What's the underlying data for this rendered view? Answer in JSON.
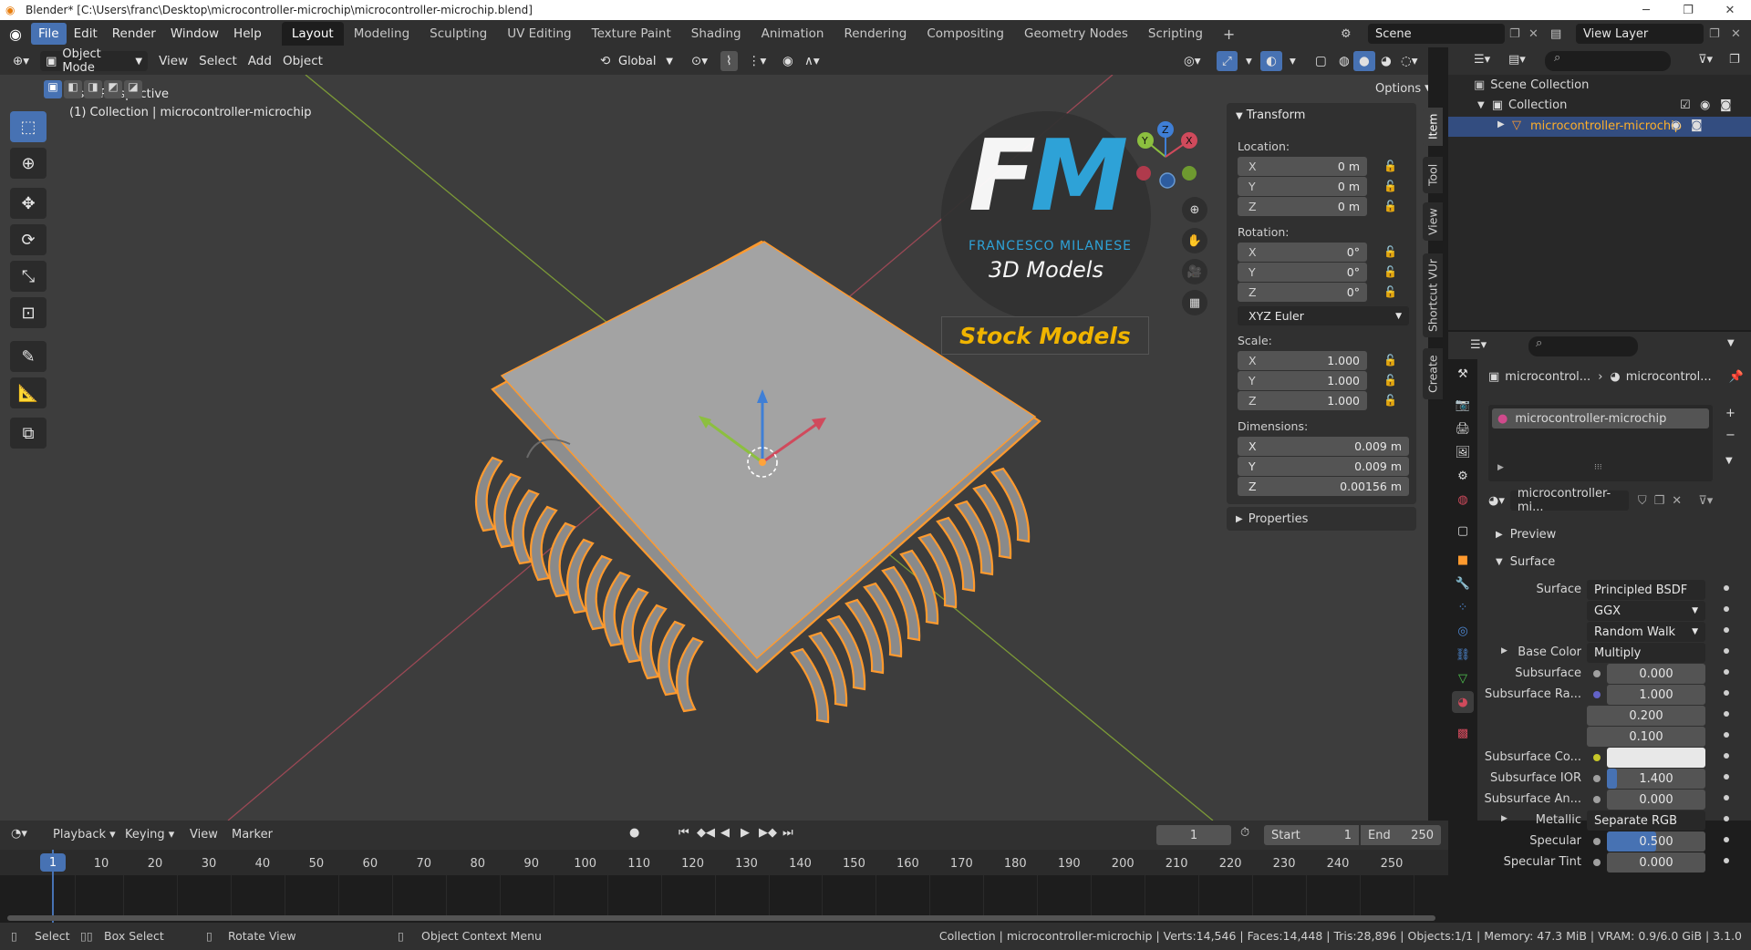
{
  "window": {
    "title": "Blender* [C:\\Users\\franc\\Desktop\\microcontroller-microchip\\microcontroller-microchip.blend]"
  },
  "menu": {
    "items": [
      "File",
      "Edit",
      "Render",
      "Window",
      "Help"
    ]
  },
  "workspaces": [
    "Layout",
    "Modeling",
    "Sculpting",
    "UV Editing",
    "Texture Paint",
    "Shading",
    "Animation",
    "Rendering",
    "Compositing",
    "Geometry Nodes",
    "Scripting"
  ],
  "scene": {
    "name": "Scene",
    "view_layer": "View Layer"
  },
  "viewport_header": {
    "mode": "Object Mode",
    "menus": [
      "View",
      "Select",
      "Add",
      "Object"
    ],
    "orientation": "Global",
    "options": "Options"
  },
  "viewport": {
    "perspective": "User Perspective",
    "collection_info": "(1) Collection | microcontroller-microchip",
    "gizmo_labels": {
      "x": "X",
      "y": "Y",
      "z": "Z"
    }
  },
  "watermark": {
    "logo_letters": "FM",
    "brand": "FRANCESCO MILANESE",
    "subtitle": "3D Models",
    "banner": "Stock Models"
  },
  "npanel": {
    "section": "Transform",
    "location_label": "Location:",
    "location": [
      {
        "axis": "X",
        "value": "0 m"
      },
      {
        "axis": "Y",
        "value": "0 m"
      },
      {
        "axis": "Z",
        "value": "0 m"
      }
    ],
    "rotation_label": "Rotation:",
    "rotation": [
      {
        "axis": "X",
        "value": "0°"
      },
      {
        "axis": "Y",
        "value": "0°"
      },
      {
        "axis": "Z",
        "value": "0°"
      }
    ],
    "rotation_mode": "XYZ Euler",
    "scale_label": "Scale:",
    "scale": [
      {
        "axis": "X",
        "value": "1.000"
      },
      {
        "axis": "Y",
        "value": "1.000"
      },
      {
        "axis": "Z",
        "value": "1.000"
      }
    ],
    "dimensions_label": "Dimensions:",
    "dimensions": [
      {
        "axis": "X",
        "value": "0.009 m"
      },
      {
        "axis": "Y",
        "value": "0.009 m"
      },
      {
        "axis": "Z",
        "value": "0.00156 m"
      }
    ],
    "properties_section": "Properties",
    "tabs": [
      "Item",
      "Tool",
      "View",
      "Shortcut VUr",
      "Create"
    ]
  },
  "outliner": {
    "root": "Scene Collection",
    "collection": "Collection",
    "object": "microcontroller-microchip"
  },
  "properties": {
    "breadcrumb_a": "microcontrol...",
    "breadcrumb_b": "microcontrol...",
    "material_slot": "microcontroller-microchip",
    "material_name": "microcontroller-mi...",
    "preview": "Preview",
    "surface_section": "Surface",
    "rows": [
      {
        "label": "Surface",
        "value": "Principled BSDF",
        "dot": "#4fc34f"
      },
      {
        "label": "",
        "value": "GGX",
        "dropdown": true
      },
      {
        "label": "",
        "value": "Random Walk",
        "dropdown": true
      },
      {
        "label": "Base Color",
        "value": "Multiply",
        "dot": "#c7c729",
        "expand": true
      },
      {
        "label": "Subsurface",
        "value": "0.000",
        "dot": "#a0a0a0",
        "num": true
      },
      {
        "label": "Subsurface Ra...",
        "value": "1.000",
        "dot": "#6363c7",
        "num": true
      },
      {
        "label": "",
        "value": "0.200",
        "num": true
      },
      {
        "label": "",
        "value": "0.100",
        "num": true
      },
      {
        "label": "Subsurface Co...",
        "value": "",
        "dot": "#c7c729",
        "swatch": "#e8e8e8"
      },
      {
        "label": "Subsurface IOR",
        "value": "1.400",
        "dot": "#a0a0a0",
        "num": true,
        "fill": 0.1
      },
      {
        "label": "Subsurface An...",
        "value": "0.000",
        "dot": "#a0a0a0",
        "num": true
      },
      {
        "label": "Metallic",
        "value": "Separate RGB",
        "dot": "#a0a0a0",
        "expand": true
      },
      {
        "label": "Specular",
        "value": "0.500",
        "dot": "#a0a0a0",
        "num": true,
        "fill": 0.5
      },
      {
        "label": "Specular Tint",
        "value": "0.000",
        "dot": "#a0a0a0",
        "num": true
      }
    ]
  },
  "timeline": {
    "menus": [
      "Playback",
      "Keying",
      "View",
      "Marker"
    ],
    "current_frame": "1",
    "start_label": "Start",
    "start": "1",
    "end_label": "End",
    "end": "250",
    "ticks": [
      "1",
      "10",
      "20",
      "30",
      "40",
      "50",
      "60",
      "70",
      "80",
      "90",
      "100",
      "110",
      "120",
      "130",
      "140",
      "150",
      "160",
      "170",
      "180",
      "190",
      "200",
      "210",
      "220",
      "230",
      "240",
      "250"
    ]
  },
  "statusbar": {
    "select": "Select",
    "box_select": "Box Select",
    "rotate_view": "Rotate View",
    "context_menu": "Object Context Menu",
    "stats": "Collection | microcontroller-microchip | Verts:14,546 | Faces:14,448 | Tris:28,896 | Objects:1/1 | Memory: 47.3 MiB | VRAM: 0.9/6.0 GiB | 3.1.0"
  },
  "colors": {
    "accent": "#4772b3",
    "selection_outline": "#ff9a2e",
    "x_axis": "#d04a5c",
    "y_axis": "#8cbf3f",
    "z_axis": "#3f7fd6"
  }
}
